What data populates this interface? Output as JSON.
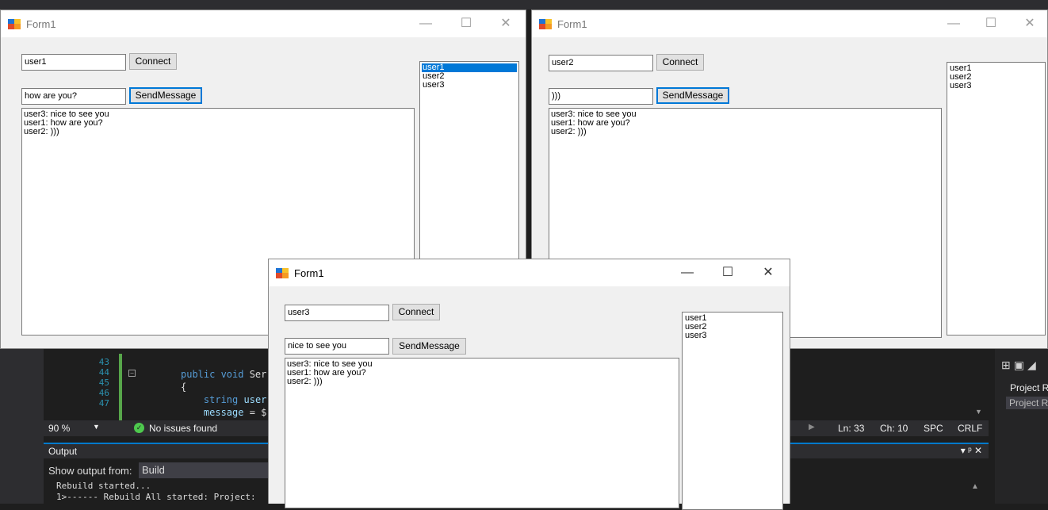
{
  "vs": {
    "line_numbers": [
      "43",
      "44",
      "45",
      "46",
      "47"
    ],
    "code": {
      "line44_kw": "public void",
      "line44_rest": " Ser",
      "line45": "{",
      "line46_kw": "string",
      "line46_rest": " user",
      "line47_ident": "message",
      "line47_rest": " = $"
    },
    "status": {
      "zoom": "90 %",
      "issues": "No issues found",
      "ln": "Ln: 33",
      "ch": "Ch: 10",
      "spc": "SPC",
      "crlf": "CRLF"
    },
    "output": {
      "title": "Output",
      "controls": "▾ ᵖ ✕",
      "show_from_label": "Show output from:",
      "show_from_value": "Build",
      "line1": "Rebuild started...",
      "line2": "1>------ Rebuild All started: Project:"
    },
    "right_panel": {
      "item1": "Project R",
      "item2": "Project R"
    }
  },
  "windows": [
    {
      "title": "Form1",
      "username": "user1",
      "connect_label": "Connect",
      "message": "how are you?",
      "send_label": "SendMessage",
      "chat": [
        "user3: nice to see you",
        "user1: how are you?",
        "user2: )))"
      ],
      "users": [
        "user1",
        "user2",
        "user3"
      ]
    },
    {
      "title": "Form1",
      "username": "user2",
      "connect_label": "Connect",
      "message": ")))",
      "send_label": "SendMessage",
      "chat": [
        "user3: nice to see you",
        "user1: how are you?",
        "user2: )))"
      ],
      "users": [
        "user1",
        "user2",
        "user3"
      ]
    },
    {
      "title": "Form1",
      "username": "user3",
      "connect_label": "Connect",
      "message": "nice to see you",
      "send_label": "SendMessage",
      "chat": [
        "user3: nice to see you",
        "user1: how are you?",
        "user2: )))"
      ],
      "users": [
        "user1",
        "user2",
        "user3"
      ]
    }
  ],
  "icons": {
    "minimize": "—",
    "maximize": "☐",
    "close": "✕"
  }
}
